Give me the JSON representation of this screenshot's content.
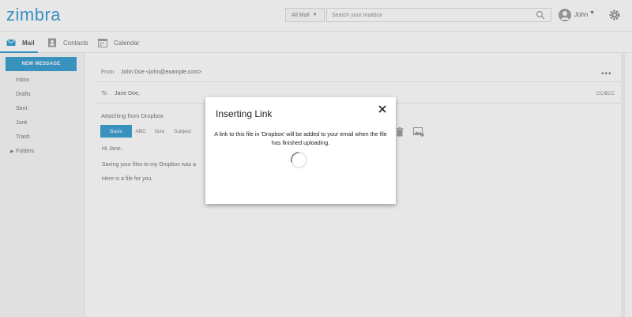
{
  "header": {
    "logo": "zimbra",
    "search_scope": "All Mail",
    "search_placeholder": "Search your mailbox",
    "user_name": "John"
  },
  "tabs": [
    {
      "label": "Mail",
      "active": true
    },
    {
      "label": "Contacts",
      "active": false
    },
    {
      "label": "Calendar",
      "active": false
    }
  ],
  "sidebar": {
    "new_message": "NEW MESSAGE",
    "folders": [
      "Inbox",
      "Drafts",
      "Sent",
      "Junk",
      "Trash",
      "Folders"
    ]
  },
  "compose": {
    "from_label": "From",
    "from_value": "John Doe <john@example.com>",
    "to_label": "To",
    "to_value": "Jane Doe,",
    "cc_bcc": "CC/BCC",
    "attach_title": "Attaching from Dropbox",
    "attach_tabs": [
      "Basic",
      "ABC",
      "Size",
      "Subject"
    ],
    "body_lines": [
      "Hi Jane,",
      "Saving your files to my Dropbox was a",
      "Here is a file for you."
    ]
  },
  "dialog": {
    "title": "Inserting Link",
    "message": "A link to this file in 'Dropbox' will be added to your email when the file has finished uploading."
  },
  "colors": {
    "accent": "#0f88c7",
    "overlay": "rgba(170,170,170,0.28)"
  },
  "icons": [
    "mail-icon",
    "contacts-icon",
    "calendar-icon",
    "search-icon",
    "gear-icon",
    "close-icon",
    "spinner-icon",
    "trash-icon",
    "image-icon"
  ]
}
